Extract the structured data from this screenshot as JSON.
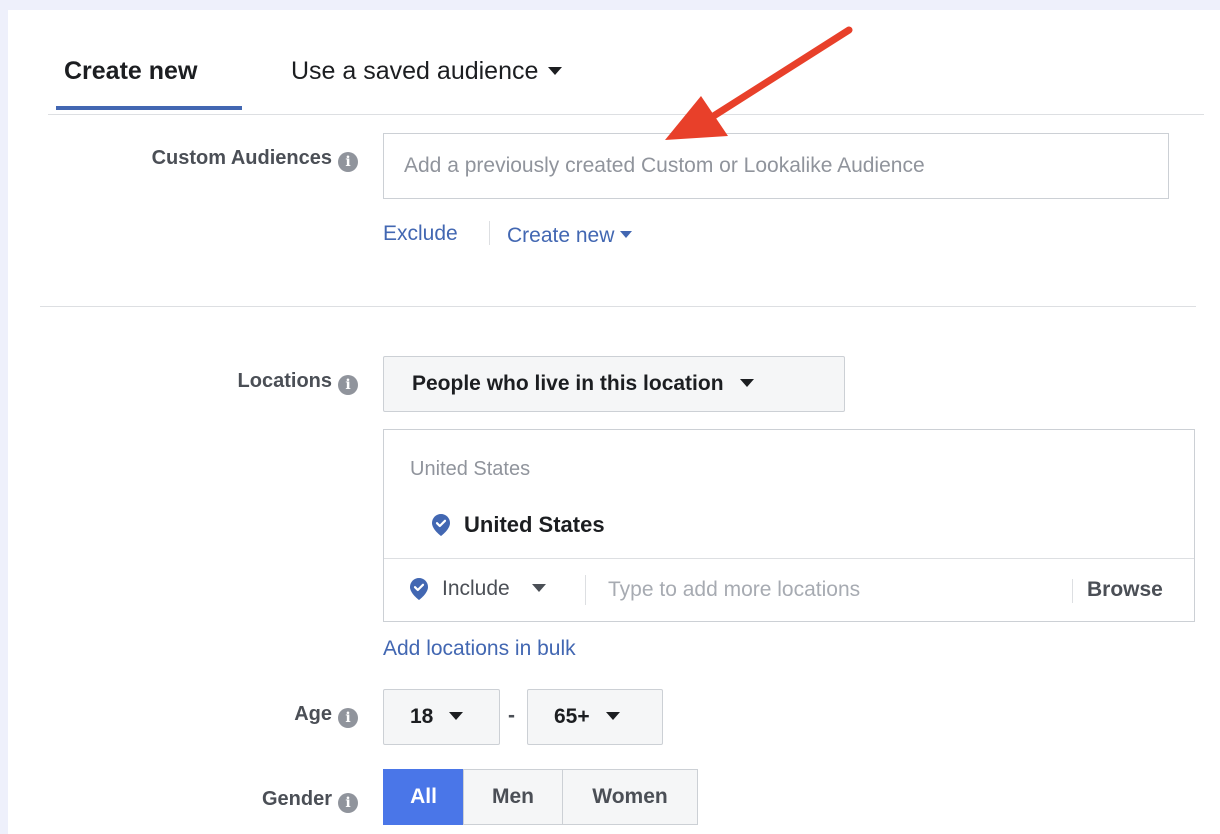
{
  "tabs": {
    "create_new": "Create new",
    "saved_audience": "Use a saved audience"
  },
  "custom_audiences": {
    "label": "Custom Audiences",
    "placeholder": "Add a previously created Custom or Lookalike Audience",
    "exclude_link": "Exclude",
    "create_new_link": "Create new"
  },
  "locations": {
    "label": "Locations",
    "dropdown_value": "People who live in this location",
    "box_title": "United States",
    "selected_location": "United States",
    "include_label": "Include",
    "search_placeholder": "Type to add more locations",
    "browse_label": "Browse",
    "bulk_link": "Add locations in bulk"
  },
  "age": {
    "label": "Age",
    "min": "18",
    "separator": "-",
    "max": "65+"
  },
  "gender": {
    "label": "Gender",
    "options": [
      "All",
      "Men",
      "Women"
    ],
    "selected": "All"
  },
  "icons": {
    "info": "info-icon",
    "pin": "location-pin-icon",
    "caret": "caret-down-icon"
  },
  "colors": {
    "accent": "#4267b2",
    "active": "#4a76e8",
    "annotation_arrow": "#e8402a"
  }
}
